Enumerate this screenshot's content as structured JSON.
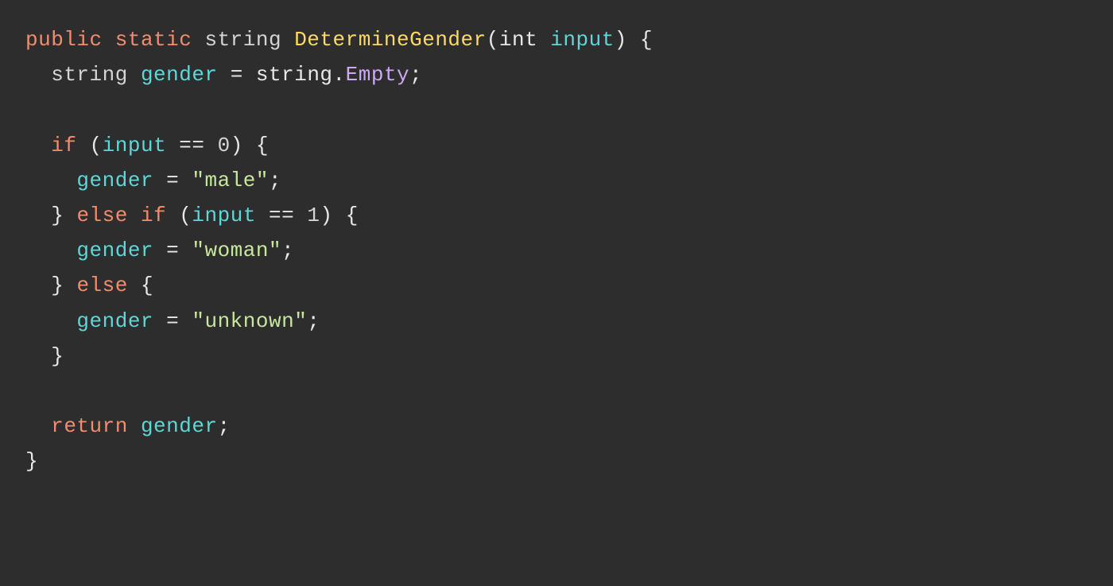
{
  "colors": {
    "background": "#2d2d2d",
    "keyword": "#f38c6f",
    "variable": "#5fd7d7",
    "property": "#cfa8f2",
    "function": "#ffd866",
    "string": "#c7e89c",
    "default": "#e8e8e8"
  },
  "code": {
    "l1": {
      "kw_public": "public",
      "kw_static": "static",
      "t_string": "string",
      "fn": "DetermineGender",
      "paren_open": "(",
      "p_type": "int",
      "p_name": "input",
      "paren_close": ")",
      "brace_open": "{"
    },
    "l2": {
      "t_string": "string",
      "var": "gender",
      "eq": "=",
      "obj": "string",
      "dot": ".",
      "prop": "Empty",
      "semi": ";"
    },
    "l4": {
      "kw_if": "if",
      "paren_open": "(",
      "var": "input",
      "cmp": "==",
      "val": "0",
      "paren_close": ")",
      "brace_open": "{"
    },
    "l5": {
      "var": "gender",
      "eq": "=",
      "str": "\"male\"",
      "semi": ";"
    },
    "l6": {
      "brace_close": "}",
      "kw_else": "else",
      "kw_if": "if",
      "paren_open": "(",
      "var": "input",
      "cmp": "==",
      "val": "1",
      "paren_close": ")",
      "brace_open": "{"
    },
    "l7": {
      "var": "gender",
      "eq": "=",
      "str": "\"woman\"",
      "semi": ";"
    },
    "l8": {
      "brace_close": "}",
      "kw_else": "else",
      "brace_open": "{"
    },
    "l9": {
      "var": "gender",
      "eq": "=",
      "str": "\"unknown\"",
      "semi": ";"
    },
    "l10": {
      "brace_close": "}"
    },
    "l12": {
      "kw_return": "return",
      "var": "gender",
      "semi": ";"
    },
    "l13": {
      "brace_close": "}"
    }
  }
}
